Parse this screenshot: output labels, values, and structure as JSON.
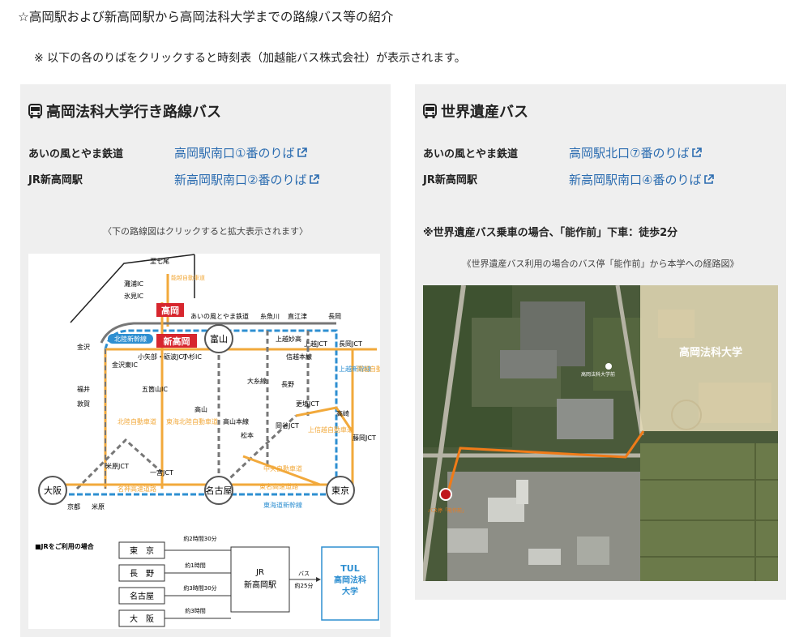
{
  "page": {
    "heading": "☆高岡駅および新高岡駅から高岡法科大学までの路線バス等の紹介",
    "note": "※ 以下の各のりばをクリックすると時刻表（加越能バス株式会社）が表示されます。"
  },
  "left_card": {
    "title": "高岡法科大学行き路線バス",
    "rows": [
      {
        "label": "あいの風とやま鉄道",
        "link": "高岡駅南口①番のりば"
      },
      {
        "label": "JR新高岡駅",
        "link": "新高岡駅南口②番のりば"
      }
    ],
    "caption": "〈下の路線図はクリックすると拡大表示されます〉",
    "route_map": {
      "stations": [
        "至七尾",
        "灘浦IC",
        "氷見IC",
        "高岡",
        "新高岡",
        "富山",
        "金沢",
        "北陸新幹線",
        "あいの風とやま鉄道",
        "糸魚川",
        "直江津",
        "長岡",
        "上越妙高",
        "上越JCT",
        "長岡JCT",
        "金沢東IC",
        "小矢部・砺波JCT",
        "小杉IC",
        "五箇山IC",
        "信越本線",
        "長野",
        "上越新幹線",
        "関越自動車道",
        "福井",
        "敦賀",
        "高山",
        "大糸線",
        "更埴JCT",
        "高崎",
        "藤岡JCT",
        "北陸自動車道",
        "東海北陸自動車道",
        "高山本線",
        "松本",
        "岡谷JCT",
        "上信越自動車道",
        "中央自動車道",
        "米原JCT",
        "一宮JCT",
        "大阪",
        "名古屋",
        "東京",
        "名神高速道路",
        "東名高速道路",
        "京都",
        "米原",
        "東海道新幹線",
        "能越自動車道"
      ],
      "jr_note": "■JRをご利用の場合",
      "origins": [
        {
          "name": "東　京",
          "time": "約2時間30分"
        },
        {
          "name": "長　野",
          "time": "約1時間"
        },
        {
          "name": "名古屋",
          "time": "約3時間30分"
        },
        {
          "name": "大　阪",
          "time": "約3時間"
        }
      ],
      "hub": "JR\n新高岡駅",
      "bus_label": "バス",
      "bus_time": "約25分",
      "dest_line1": "TUL",
      "dest_line2": "高岡法科",
      "dest_line3": "大学"
    }
  },
  "right_card": {
    "title": "世界遺産バス",
    "rows": [
      {
        "label": "あいの風とやま鉄道",
        "link": "高岡駅北口⑦番のりば"
      },
      {
        "label": "JR新高岡駅",
        "link": "新高岡駅南口④番のりば"
      }
    ],
    "note": "※世界遺産バス乗車の場合、「能作前」下車：徒歩2分",
    "caption": "《世界遺産バス利用の場合のバス停「能作前」から本学への経路図》",
    "aerial": {
      "campus_label": "高岡法科大学",
      "small_label": "高岡法科大学前",
      "stop_label": "バス停「能作前」"
    }
  },
  "colors": {
    "link": "#2b6cb0",
    "card_bg": "#efefef",
    "route_orange": "#f07b18",
    "stop_red": "#c0161c",
    "map_red": "#d7262e",
    "map_blue": "#2e8fd1",
    "map_yellow": "#f2a93b"
  }
}
